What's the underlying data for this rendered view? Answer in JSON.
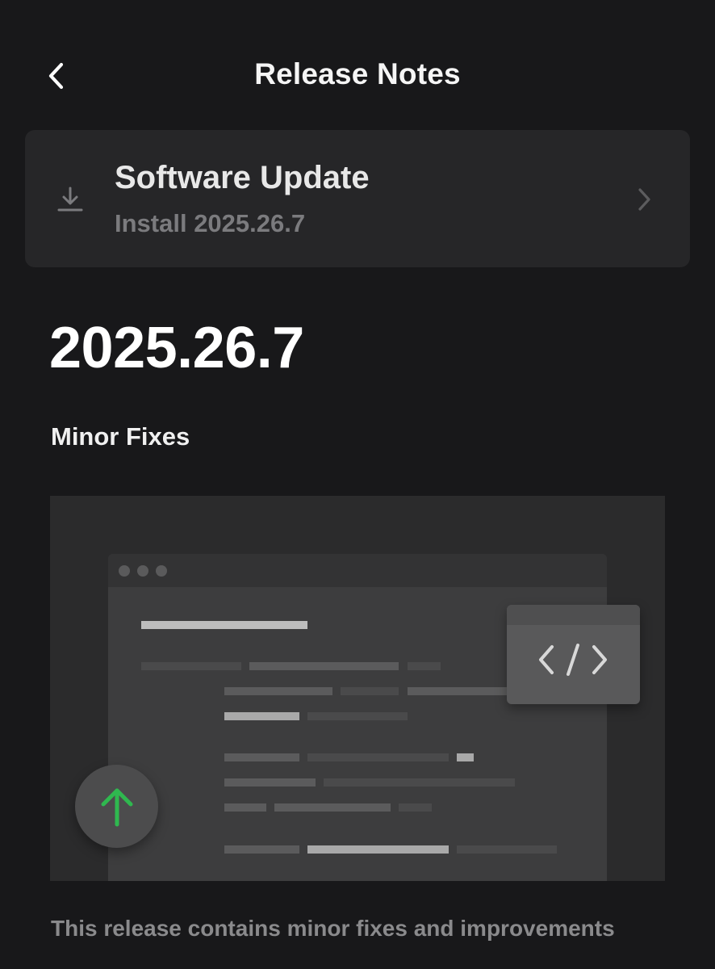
{
  "header": {
    "title": "Release Notes",
    "back_icon": "chevron-left-icon"
  },
  "update_card": {
    "title": "Software Update",
    "subtitle": "Install 2025.26.7",
    "leading_icon": "download-icon",
    "trailing_icon": "chevron-right-icon"
  },
  "release": {
    "version": "2025.26.7",
    "heading": "Minor Fixes",
    "description": "This release contains minor fixes and improvements"
  },
  "illustration": {
    "code_icon": "code-brackets-icon",
    "upgrade_icon": "arrow-up-icon",
    "accent_color": "#2fb84f"
  },
  "colors": {
    "background": "#18181a",
    "card": "#262628",
    "muted_text": "#7b7b7e"
  }
}
